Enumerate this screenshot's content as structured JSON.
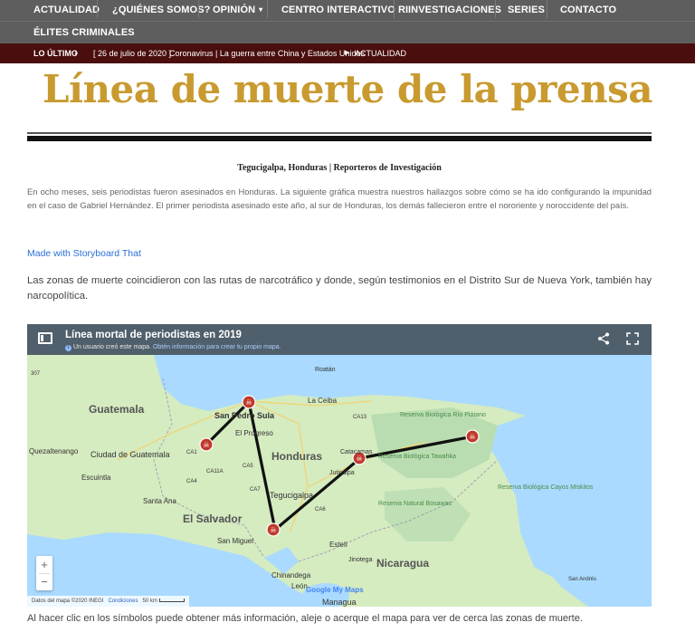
{
  "nav": {
    "items": [
      "ACTUALIDAD",
      "¿QUIÉNES SOMOS?",
      "OPINIÓN",
      "CENTRO INTERACTIVO RI",
      "INVESTIGACIONES",
      "SERIES",
      "CONTACTO"
    ],
    "row2": [
      "ÉLITES CRIMINALES"
    ]
  },
  "ticker": {
    "label": "LO ÚLTIMO",
    "date": "[ 26 de julio de 2020 ]",
    "headline": "Coronavirus | La guerra entre China y Estados Unidos",
    "category": "ACTUALIDAD"
  },
  "article": {
    "title": "Línea de muerte de la prensa",
    "byline": "Tegucigalpa, Honduras | Reporteros de Investigación",
    "intro": "En ocho meses, seis periodistas fueron asesinados en Honduras. La siguiente gráfica muestra nuestros hallazgos sobre cómo se ha ido configurando la impunidad en el caso de Gabriel Hernández. El primer periodista asesinado este año, al sur de Honduras, los demás fallecieron entre el nororiente y noroccidente del país.",
    "link": "Made with Storyboard That",
    "paragraph": "Las zonas de muerte coincidieron con las rutas de narcotráfico y donde, según testimonios en el Distrito Sur de Nueva York, también hay narcopolítica.",
    "footer": "Al hacer clic en los símbolos puede obtener más información, aleje o acerque el mapa para ver de cerca las zonas de muerte."
  },
  "map": {
    "title": "Línea mortal de periodistas en 2019",
    "star": "☆",
    "subtitle": "Un usuario creó este mapa.",
    "subtitle_link": "Obtén información para crear tu propio mapa.",
    "zoom_in": "+",
    "zoom_out": "−",
    "credit": "Datos del mapa ©2020 INEGI",
    "credit_link": "Condiciones",
    "scale": "50 km",
    "brand": "Google My Maps",
    "labels": {
      "guatemala": "Guatemala",
      "ciudad": "Ciudad de Guatemala",
      "quetzaltenango": "Quezaltenango",
      "escuintla": "Escuintla",
      "santa_ana": "Santa Ana",
      "el_salvador": "El Salvador",
      "san_miguel": "San Miguel",
      "honduras": "Honduras",
      "san_pedro": "San Pedro Sula",
      "el_progreso": "El Progreso",
      "tegucigalpa": "Tegucigalpa",
      "la_ceiba": "La Ceiba",
      "roatan": "Roatán",
      "catacamas": "Catacamas",
      "juticalpa": "Juticalpa",
      "nicaragua": "Nicaragua",
      "managua": "Managua",
      "chinandega": "Chinandega",
      "esteli": "Estelí",
      "leon": "León",
      "jinotega": "Jinotega",
      "rio_platano": "Reserva Biológica Río Plátano",
      "tawahka": "Reserva Biológica Tawahka",
      "bosawas": "Reserva Natural Bosawas",
      "cayos": "Reserva Biológica Cayos Miskitos",
      "san_andres": "San Andrés",
      "ca1": "CA1",
      "ca5": "CA5",
      "ca7": "CA7",
      "ca11a": "CA11A",
      "ca4": "CA4",
      "ca6": "CA6",
      "ca13": "CA13",
      "r307": "307"
    },
    "colors": {
      "marker": "#c0392b",
      "route": "#111111",
      "land": "#d8ecc4",
      "water": "#aadaff"
    }
  }
}
